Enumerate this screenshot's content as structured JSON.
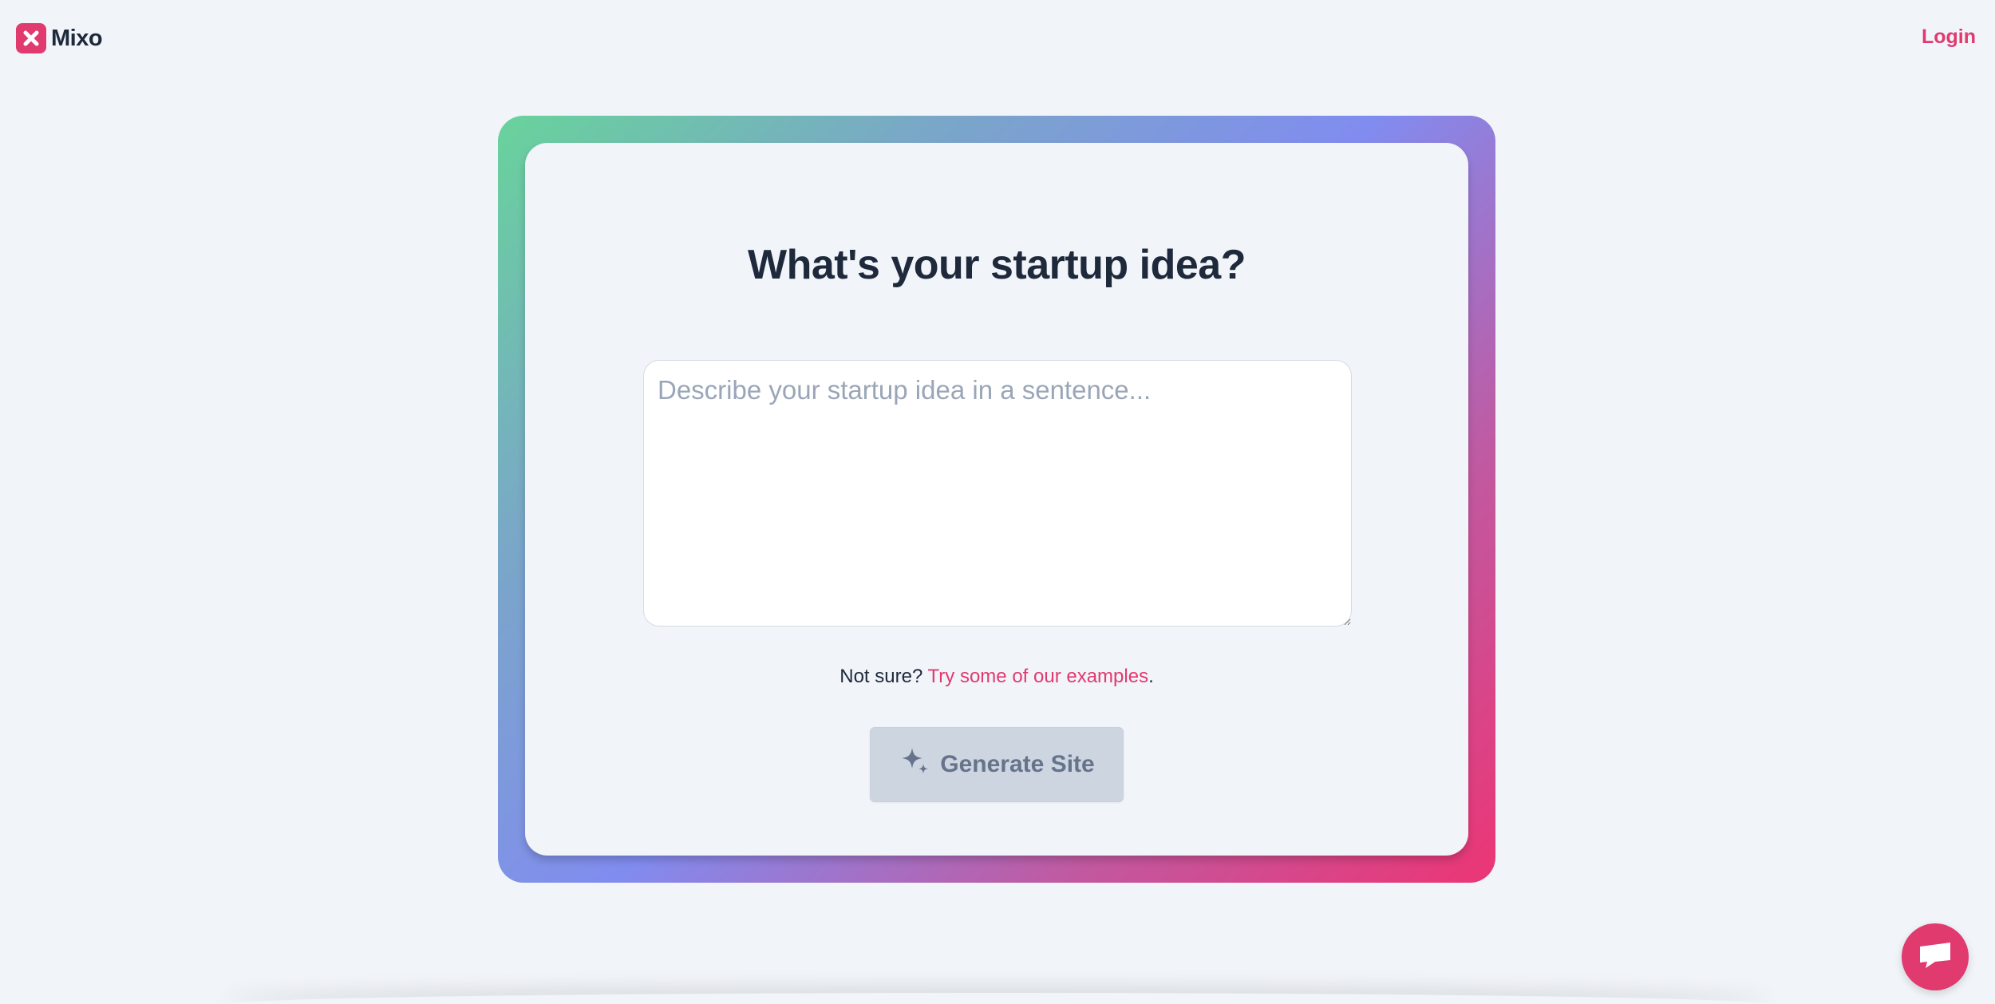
{
  "header": {
    "brand": "Mixo",
    "login_label": "Login"
  },
  "main": {
    "title": "What's your startup idea?",
    "idea_input": {
      "value": "",
      "placeholder": "Describe your startup idea in a sentence..."
    },
    "helper_prefix": "Not sure?",
    "examples_link": "Try some of our examples",
    "helper_suffix": ".",
    "generate_label": "Generate Site",
    "generate_icon": "sparkles-icon",
    "generate_disabled": true
  },
  "chat": {
    "icon": "chat-bubble-icon"
  },
  "colors": {
    "accent": "#e03a6f",
    "text": "#1e293b",
    "background": "#f1f4f9",
    "button_disabled": "#cdd5e0",
    "gradient_start": "#68d39b",
    "gradient_mid": "#818cf0",
    "gradient_end": "#ec3574"
  }
}
